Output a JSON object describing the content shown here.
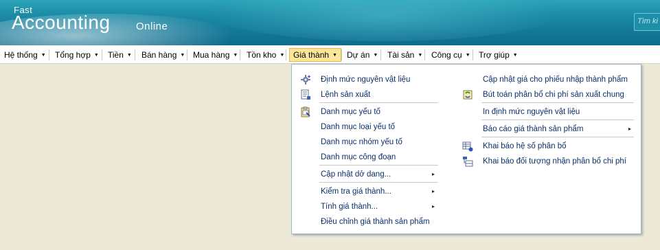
{
  "header": {
    "logo_fast": "Fast",
    "logo_accounting": "Accounting",
    "logo_online": "Online",
    "search_placeholder": "Tìm ki"
  },
  "menubar": {
    "items": [
      {
        "label": "Hệ thống"
      },
      {
        "label": "Tổng hợp"
      },
      {
        "label": "Tiền"
      },
      {
        "label": "Bán hàng"
      },
      {
        "label": "Mua hàng"
      },
      {
        "label": "Tồn kho"
      },
      {
        "label": "Giá thành"
      },
      {
        "label": "Dự án"
      },
      {
        "label": "Tài sản"
      },
      {
        "label": "Công cụ"
      },
      {
        "label": "Trợ giúp"
      }
    ],
    "active_index": 6
  },
  "dropdown": {
    "left_column": [
      {
        "label": "Định mức nguyên vật liệu",
        "icon": "gear-sparkle-icon"
      },
      {
        "label": "Lệnh sản xuất",
        "icon": "document-list-icon"
      },
      {
        "label": "Danh mục yếu tố",
        "icon": "clipboard-icon"
      },
      {
        "label": "Danh mục loại yếu tố"
      },
      {
        "label": "Danh mục nhóm yếu tố"
      },
      {
        "label": "Danh mục công đoạn"
      },
      {
        "label": "Cập nhật dở dang...",
        "submenu": true
      },
      {
        "label": "Kiểm tra giá thành...",
        "submenu": true
      },
      {
        "label": "Tính giá thành...",
        "submenu": true
      },
      {
        "label": "Điều chỉnh giá thành sản phẩm"
      }
    ],
    "right_column": [
      {
        "label": "Cập nhật giá cho phiếu nhập thành phẩm"
      },
      {
        "label": "Bút toán phân bổ chi phí sản xuất chung",
        "icon": "refresh-doc-icon"
      },
      {
        "label": "In định mức nguyên vật liệu"
      },
      {
        "label": "Báo cáo giá thành sản phẩm",
        "submenu": true
      },
      {
        "label": "Khai báo hệ số phân bổ",
        "icon": "table-settings-icon"
      },
      {
        "label": "Khai báo đối tượng nhận phân bổ chi phí",
        "icon": "tree-table-icon"
      }
    ],
    "submenu_arrow": "▸"
  },
  "colors": {
    "menu_text": "#000000",
    "dropdown_text": "#0b2f6a",
    "active_bg": "#fbe69a",
    "header_accent": "#1b8aa5"
  }
}
